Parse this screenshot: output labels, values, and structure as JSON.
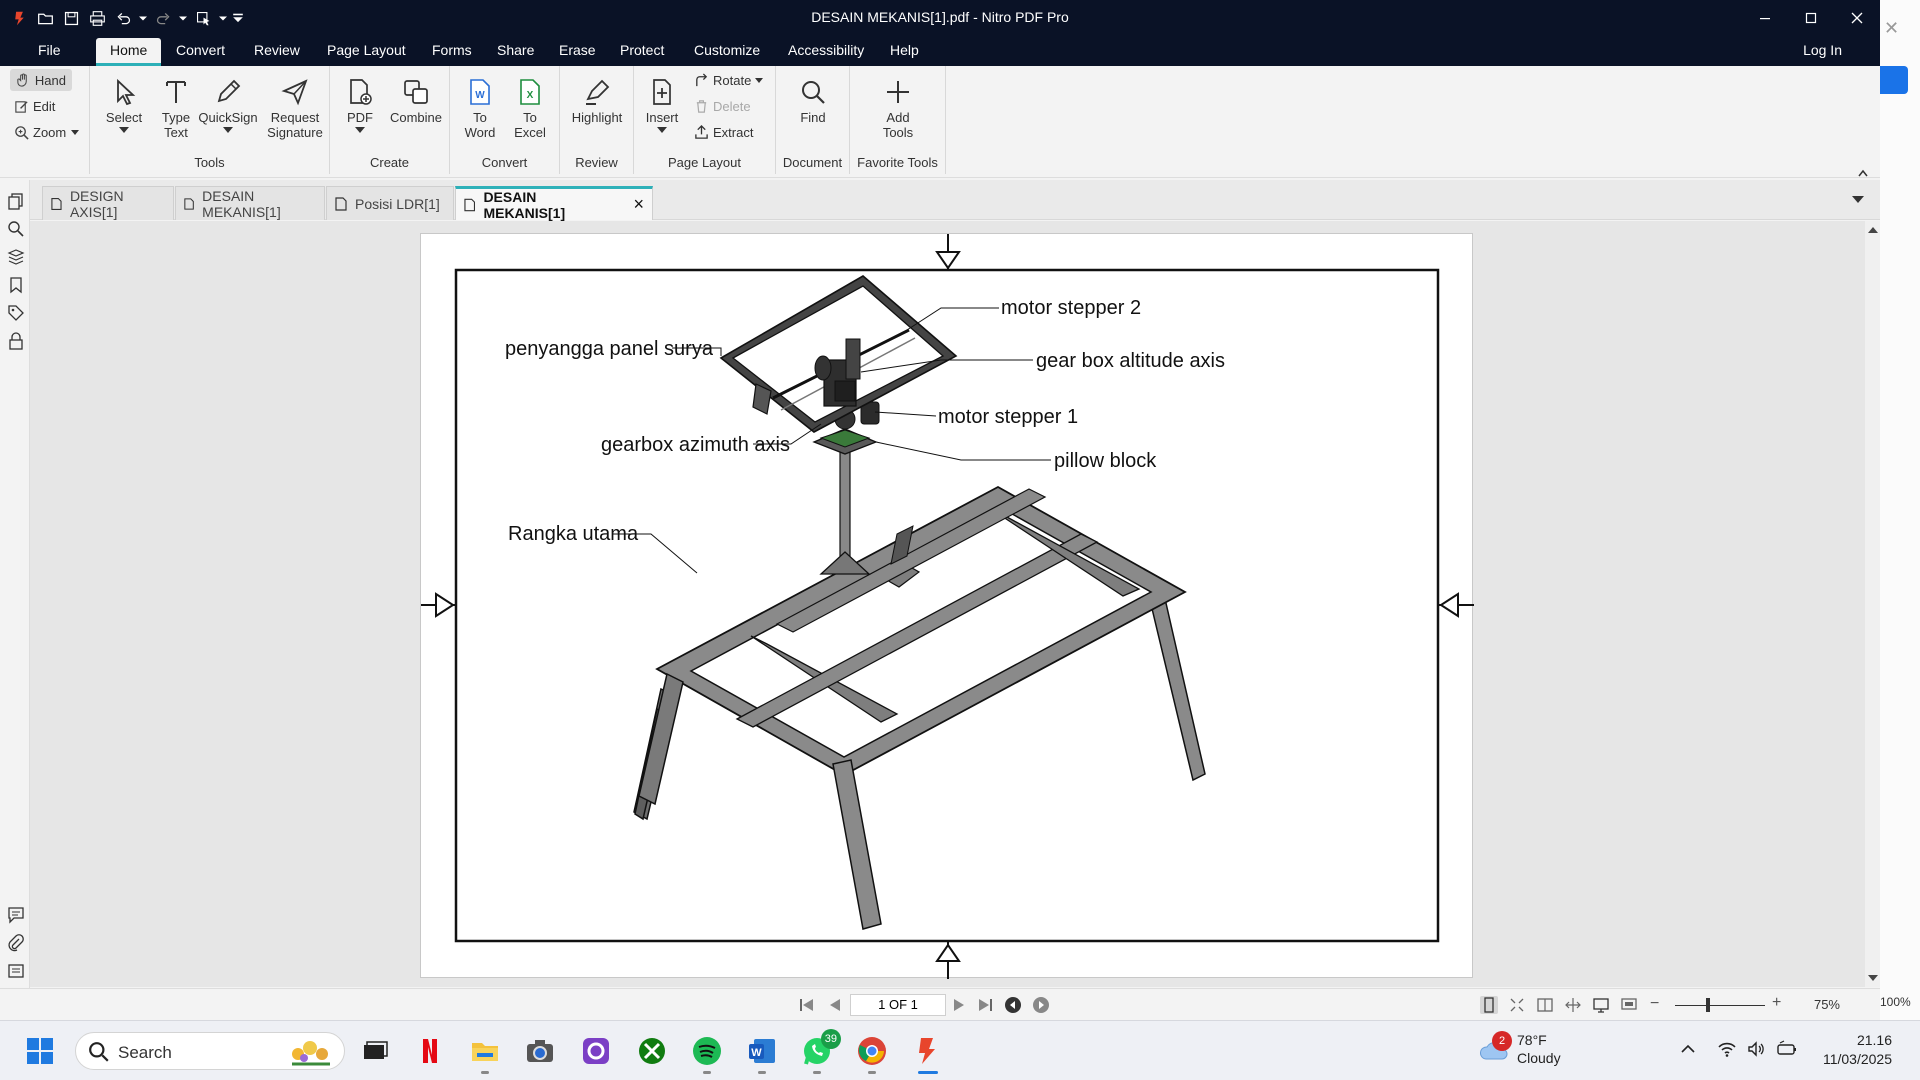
{
  "window": {
    "title": "DESAIN MEKANIS[1].pdf - Nitro PDF Pro"
  },
  "menu": {
    "items": [
      "File",
      "Home",
      "Convert",
      "Review",
      "Page Layout",
      "Forms",
      "Share",
      "Erase",
      "Protect",
      "Customize",
      "Accessibility",
      "Help"
    ],
    "login": "Log In"
  },
  "ribbon": {
    "mode": {
      "hand": "Hand",
      "edit": "Edit",
      "zoom": "Zoom"
    },
    "tools": {
      "select": "Select",
      "type_text": "Type Text",
      "quicksign": "QuickSign",
      "request_signature": "Request Signature",
      "group": "Tools"
    },
    "create": {
      "pdf": "PDF",
      "combine": "Combine",
      "group": "Create"
    },
    "convert": {
      "to_word": "To Word",
      "to_excel": "To Excel",
      "group": "Convert"
    },
    "review": {
      "highlight": "Highlight",
      "group": "Review"
    },
    "page_layout": {
      "insert": "Insert",
      "rotate": "Rotate",
      "delete": "Delete",
      "extract": "Extract",
      "group": "Page Layout"
    },
    "document": {
      "find": "Find",
      "group": "Document"
    },
    "favorite": {
      "add_tools": "Add Tools",
      "group": "Favorite Tools"
    }
  },
  "tabs": [
    {
      "label": "DESIGN AXIS[1]",
      "active": false
    },
    {
      "label": "DESAIN MEKANIS[1]",
      "active": false
    },
    {
      "label": "Posisi LDR[1]",
      "active": false
    },
    {
      "label": "DESAIN MEKANIS[1]",
      "active": true
    }
  ],
  "drawing": {
    "labels": {
      "motor_stepper_2": "motor stepper 2",
      "penyangga": "penyangga panel surya",
      "gear_box_altitude": "gear box altitude axis",
      "motor_stepper_1": "motor stepper 1",
      "gearbox_azimuth": "gearbox azimuth axis",
      "pillow_block": "pillow block",
      "rangka_utama": "Rangka utama"
    }
  },
  "status": {
    "page_indicator": "1 OF 1",
    "zoom": "75%"
  },
  "background": {
    "right_zoom": "100%"
  },
  "taskbar": {
    "search": "Search",
    "whatsapp_badge": "39",
    "weather_badge": "2",
    "temperature": "78°F",
    "condition": "Cloudy",
    "time": "21.16",
    "date": "11/03/2025"
  }
}
